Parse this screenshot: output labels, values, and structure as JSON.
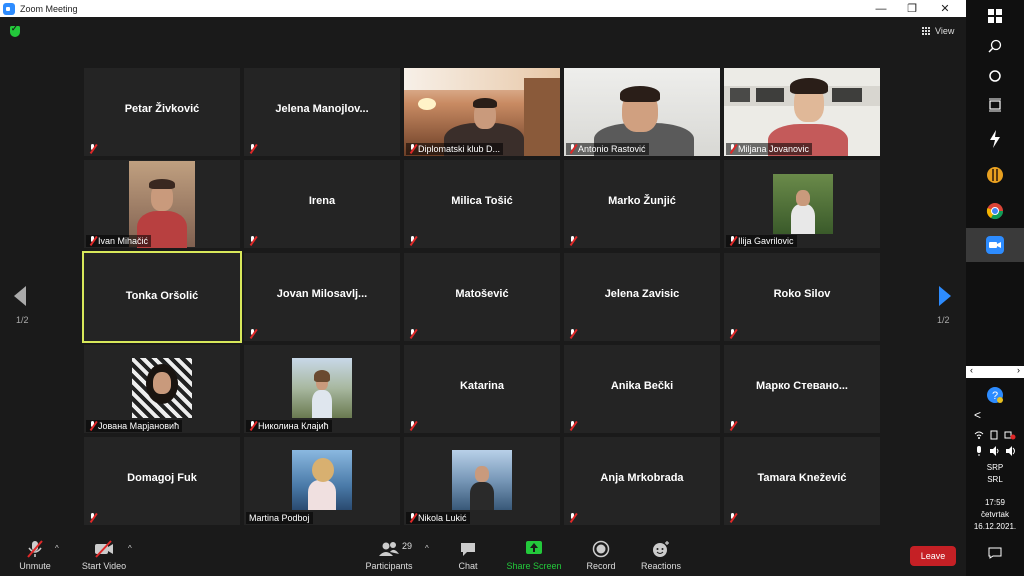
{
  "window": {
    "title": "Zoom Meeting",
    "minimize": "—",
    "restore": "❐",
    "close": "✕"
  },
  "header": {
    "view_label": "View"
  },
  "grid": {
    "page_left": "1/2",
    "page_right": "1/2",
    "tiles": [
      {
        "name": "Petar Živković",
        "video": false
      },
      {
        "name": "Jelena  Manojlov...",
        "video": false
      },
      {
        "name": "Diplomatski klub D...",
        "video": true
      },
      {
        "name": "Antonio Rastović",
        "video": true
      },
      {
        "name": "Miljana Jovanovic",
        "video": true
      },
      {
        "name": "Ivan Mihačić",
        "video": "photo"
      },
      {
        "name": "Irena",
        "video": false
      },
      {
        "name": "Milica Tošić",
        "video": false
      },
      {
        "name": "Marko Žunjić",
        "video": false
      },
      {
        "name": "Ilija Gavrilovic",
        "video": "photo"
      },
      {
        "name": "Tonka Oršolić",
        "video": false,
        "active": true
      },
      {
        "name": "Jovan  Milosavlj...",
        "video": false
      },
      {
        "name": "Matošević",
        "video": false
      },
      {
        "name": "Jelena Zavisic",
        "video": false
      },
      {
        "name": "Roko Silov",
        "video": false
      },
      {
        "name": "Јована Марјановић",
        "video": "photo"
      },
      {
        "name": "Николина Клајић",
        "video": "photo"
      },
      {
        "name": "Katarina",
        "video": false
      },
      {
        "name": "Anika Bečki",
        "video": false
      },
      {
        "name": "Марко  Стевано...",
        "video": false
      },
      {
        "name": "Domagoj Fuk",
        "video": false
      },
      {
        "name": "Martina Podboj",
        "video": "photo"
      },
      {
        "name": "Nikola Lukić",
        "video": "photo"
      },
      {
        "name": "Anja Mrkobrada",
        "video": false
      },
      {
        "name": "Tamara Knežević",
        "video": false
      }
    ]
  },
  "toolbar": {
    "unmute": "Unmute",
    "start_video": "Start Video",
    "participants": "Participants",
    "participant_count": "29",
    "chat": "Chat",
    "share_screen": "Share Screen",
    "record": "Record",
    "reactions": "Reactions",
    "leave": "Leave",
    "caret": "^"
  },
  "taskbar": {
    "language_1": "SRP",
    "language_2": "SRL",
    "time": "17:59",
    "day": "četvrtak",
    "date": "16.12.2021.",
    "tray_expand": "<"
  },
  "colors": {
    "accent_blue": "#2d8cff",
    "share_green": "#23c93b",
    "leave_red": "#c52025",
    "active_speaker": "#d8e85a"
  }
}
